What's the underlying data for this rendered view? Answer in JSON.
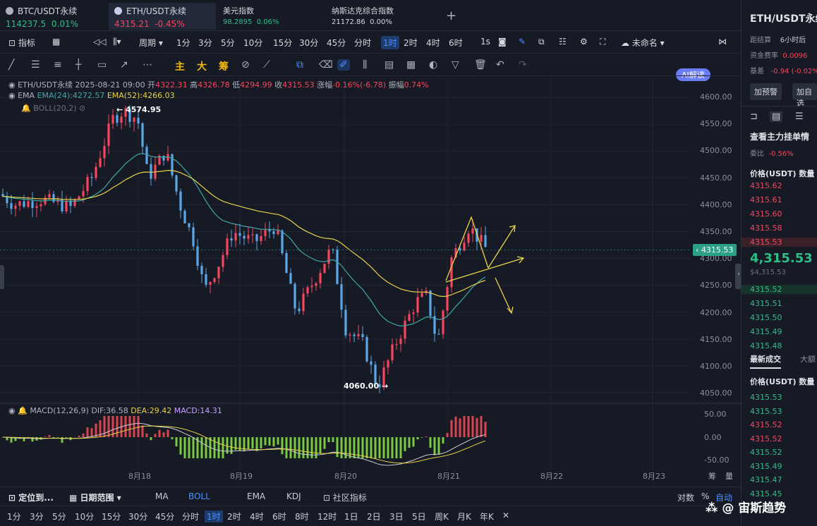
{
  "tabs": [
    {
      "name": "BTC/USDT永续",
      "price": "114237.5",
      "change": "0.01%",
      "color": "green"
    },
    {
      "name": "ETH/USDT永续",
      "price": "4315.21",
      "change": "-0.45%",
      "color": "red"
    },
    {
      "name": "美元指数",
      "price": "98.2895",
      "change": "0.06%",
      "color": "green"
    },
    {
      "name": "纳斯达克综合指数",
      "price": "21172.86",
      "change": "0.00%",
      "color": "gray"
    }
  ],
  "add_tab": "+",
  "toolbar": {
    "indicators": "指标",
    "period": "周期",
    "intervals": [
      "1分",
      "3分",
      "5分",
      "10分",
      "15分",
      "30分",
      "45分",
      "分时",
      "1时",
      "2时",
      "4时",
      "6时"
    ],
    "selected_interval": "1时",
    "one_s": "1s",
    "unnamed": "未命名",
    "ai": "AI解读"
  },
  "drawtools": {
    "labels": [
      "主",
      "大",
      "筹"
    ]
  },
  "legend": {
    "line1_symbol": "ETH/USDT永续",
    "line1_time": "2025-08-21 09:00",
    "open_label": "开",
    "open": "4322.31",
    "high_label": "高",
    "high": "4326.78",
    "low_label": "低",
    "low": "4294.99",
    "close_label": "收",
    "close": "4315.53",
    "chg_label": "涨幅",
    "chg": "-0.16%(-6.78)",
    "amp_label": "振幅",
    "amp": "0.74%",
    "ema": "EMA",
    "ema24": "EMA(24):4272.57",
    "ema52": "EMA(52):4266.03",
    "boll": "BOLL(20,2)",
    "macd": "MACD(12,26,9)",
    "dif": "DIF:36.58",
    "dea": "DEA:29.42",
    "macdv": "MACD:14.31"
  },
  "annotations": {
    "high": "4574.95",
    "low": "4060.00"
  },
  "price_axis": [
    "4600.00",
    "4550.00",
    "4500.00",
    "4450.00",
    "4400.00",
    "4350.00",
    "4300.00",
    "4250.00",
    "4200.00",
    "4150.00",
    "4100.00",
    "4050.00"
  ],
  "current_price": "4315.53",
  "macd_axis": [
    "50.00",
    "0.00",
    "-50.00"
  ],
  "date_axis": [
    "8月18",
    "8月19",
    "8月20",
    "8月21",
    "8月22",
    "8月23"
  ],
  "axis_corner": [
    "筹",
    "量"
  ],
  "bottom1": {
    "locate": "定位到...",
    "range": "日期范围",
    "items": [
      "MA",
      "BOLL",
      "EMA",
      "KDJ"
    ],
    "selected": "BOLL",
    "community": "社区指标",
    "right": [
      "对数",
      "%",
      "自动"
    ]
  },
  "bottom2": {
    "items": [
      "1分",
      "3分",
      "5分",
      "10分",
      "15分",
      "30分",
      "45分",
      "分时",
      "1时",
      "2时",
      "4时",
      "6时",
      "8时",
      "12时",
      "1日",
      "2日",
      "3日",
      "5日",
      "周K",
      "月K",
      "年K"
    ],
    "selected": "1时",
    "close": "✕"
  },
  "side": {
    "title": "ETH/USDT永续",
    "settle_label": "距结算",
    "settle": "6小时后",
    "funding_label": "资金费率",
    "funding": "0.0096",
    "basis_label": "基差",
    "basis": "-0.94 (-0.02%)",
    "alert_btn": "加预警",
    "custom_btn": "加自选",
    "orderbook_title": "查看主力挂单情",
    "ratio_label": "委比",
    "ratio": "-0.56%",
    "price_header": "价格(USDT)",
    "qty_header": "数量",
    "asks": [
      "4315.62",
      "4315.61",
      "4315.60",
      "4315.58",
      "4315.53"
    ],
    "last": "4,315.53",
    "mark": "$4,315.53",
    "bids": [
      "4315.52",
      "4315.51",
      "4315.50",
      "4315.49",
      "4315.48"
    ],
    "trades_tab": "最新成交",
    "big_tab": "大额",
    "trades": [
      {
        "p": "4315.53",
        "c": "green"
      },
      {
        "p": "4315.53",
        "c": "green"
      },
      {
        "p": "4315.52",
        "c": "red"
      },
      {
        "p": "4315.52",
        "c": "red"
      },
      {
        "p": "4315.52",
        "c": "green"
      },
      {
        "p": "4315.49",
        "c": "green"
      },
      {
        "p": "4315.47",
        "c": "green"
      },
      {
        "p": "4315.45",
        "c": "green"
      }
    ]
  },
  "watermark": "@ 宙斯趋势",
  "colors": {
    "up": "#f6465d",
    "down": "#5aa6e8",
    "ema24": "#e7d14a",
    "ema52": "#3fa8a8",
    "accent": "#4f8ff7"
  },
  "chart_data": {
    "type": "candlestick",
    "interval": "1h",
    "ylim": [
      4040,
      4620
    ],
    "xlabels": [
      "8月18",
      "8月19",
      "8月20",
      "8月21",
      "8月22",
      "8月23"
    ],
    "key_points": {
      "high": 4574.95,
      "low": 4060.0,
      "current": 4315.53
    }
  }
}
